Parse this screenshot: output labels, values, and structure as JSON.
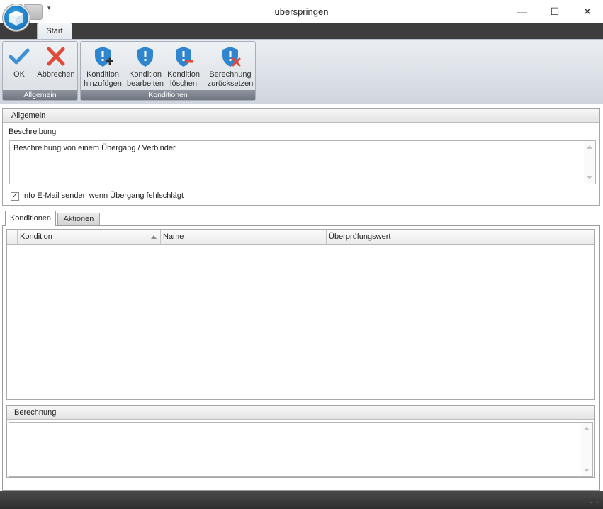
{
  "window": {
    "title": "überspringen",
    "minimize_glyph": "—",
    "maximize_glyph": "☐",
    "close_glyph": "✕",
    "qat_glyph": "▾"
  },
  "ribbon": {
    "tabs": [
      {
        "label": "Start",
        "active": true
      }
    ],
    "groups": [
      {
        "label": "Allgemein",
        "buttons": [
          {
            "label": "OK",
            "icon": "checkmark-icon"
          },
          {
            "label": "Abbrechen",
            "icon": "cancel-x-icon"
          }
        ]
      },
      {
        "label": "Konditionen",
        "buttons": [
          {
            "line1": "Kondition",
            "line2": "hinzufügen",
            "icon": "shield-add-icon"
          },
          {
            "line1": "Kondition",
            "line2": "bearbeiten",
            "icon": "shield-edit-icon"
          },
          {
            "line1": "Kondition",
            "line2": "löschen",
            "icon": "shield-remove-icon"
          },
          {
            "line1": "Berechnung",
            "line2": "zurücksetzen",
            "icon": "shield-reset-icon"
          }
        ]
      }
    ]
  },
  "allgemein": {
    "header": "Allgemein",
    "description_label": "Beschreibung",
    "description_value": "Beschreibung von einem Übergang / Verbinder",
    "checkbox_label": "Info E-Mail senden wenn Übergang fehlschlägt",
    "checkbox_checked": true,
    "check_glyph": "✓"
  },
  "tabs": [
    {
      "label": "Konditionen",
      "active": true
    },
    {
      "label": "Aktionen",
      "active": false
    }
  ],
  "conditions_grid": {
    "columns": [
      "Kondition",
      "Name",
      "Überprüfungswert"
    ],
    "sorted_column": "Kondition",
    "sort_direction": "ascending",
    "rows": []
  },
  "berechnung": {
    "header": "Berechnung",
    "value": ""
  },
  "colors": {
    "ok_blue": "#3d8fd6",
    "cancel_red": "#e04a3a",
    "shield_blue": "#2f86cf",
    "add_green": "#2e2e2e",
    "remove_red": "#e04a3a"
  }
}
